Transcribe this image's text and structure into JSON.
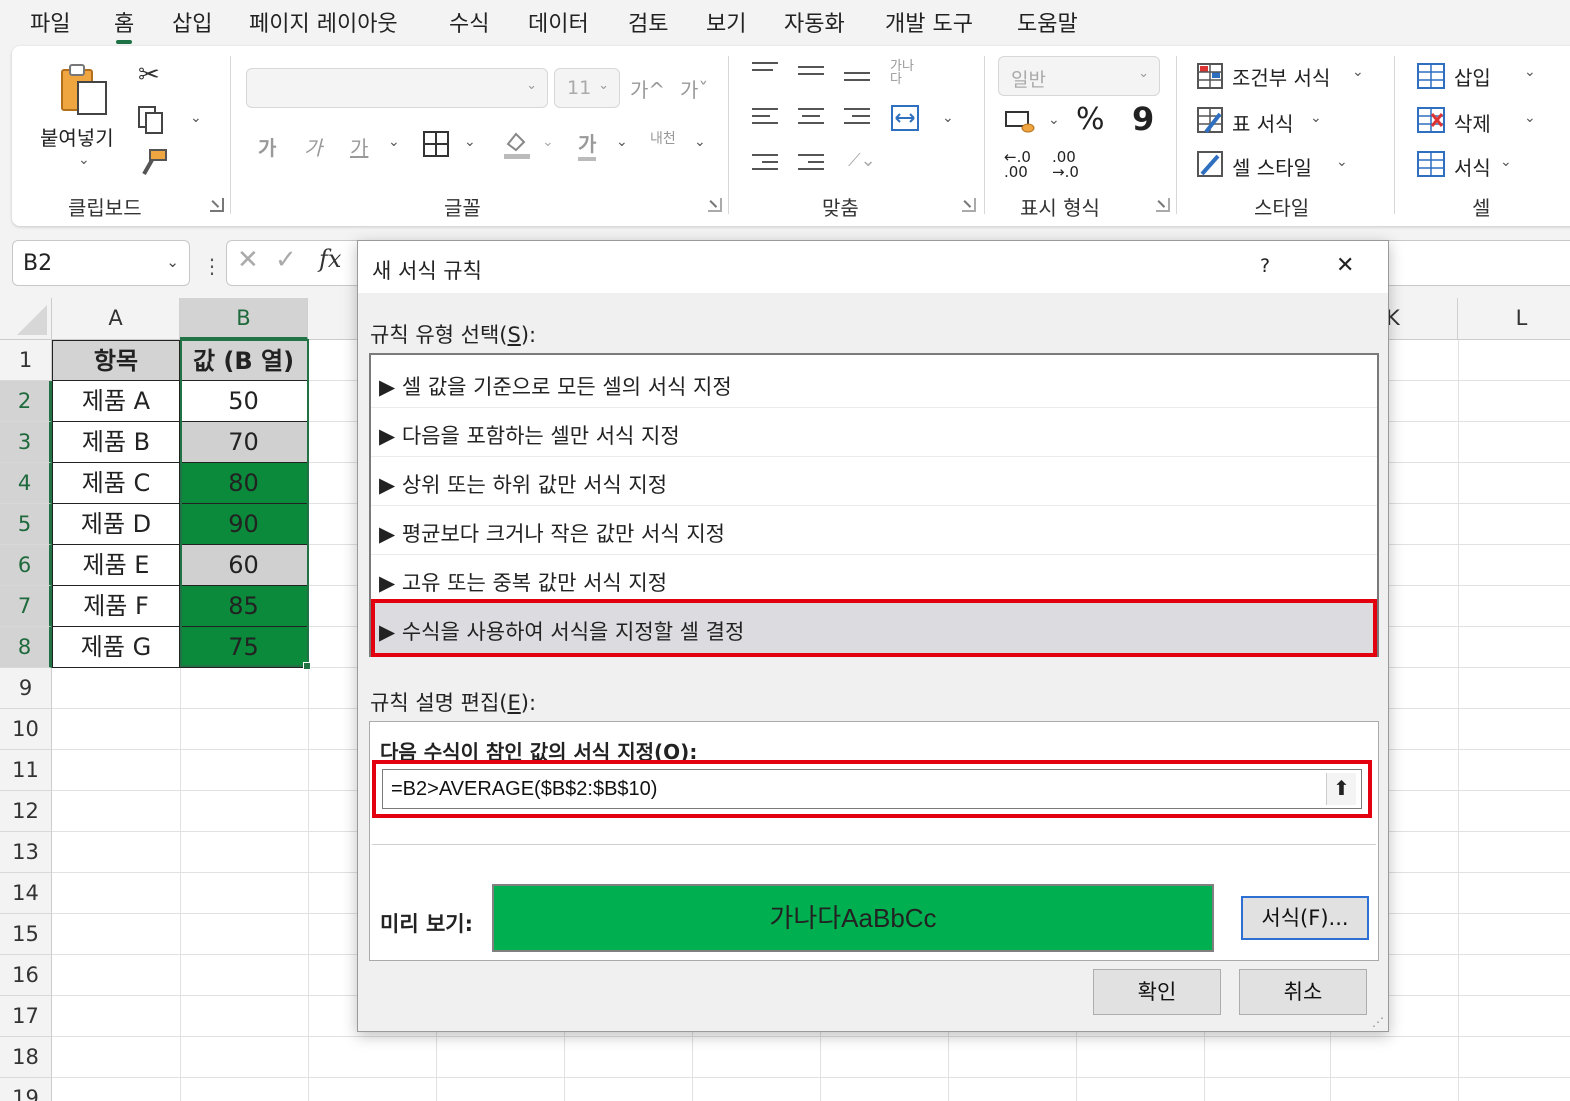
{
  "menu": {
    "tabs": [
      "파일",
      "홈",
      "삽입",
      "페이지 레이아웃",
      "수식",
      "데이터",
      "검토",
      "보기",
      "자동화",
      "개발 도구",
      "도움말"
    ],
    "active": "홈"
  },
  "ribbon": {
    "clipboard": {
      "label": "클립보드",
      "paste": "붙여넣기"
    },
    "font": {
      "label": "글꼴",
      "size": "11",
      "increase": "가^",
      "decrease": "가ˇ",
      "bold": "가",
      "italic": "가",
      "underline": "가",
      "font_color": "가",
      "wrap_label": "내천"
    },
    "align": {
      "label": "맞춤",
      "orient": "가나다"
    },
    "number": {
      "label": "표시 형식",
      "format": "일반",
      "percent": "%",
      "comma": "9",
      "inc_dec": "←.0 .00",
      "dec_dec": ".00 →.0"
    },
    "styles": {
      "label": "스타일",
      "cond_format": "조건부 서식",
      "table_format": "표 서식",
      "cell_style": "셀 스타일"
    },
    "cells": {
      "label": "셀",
      "insert": "삽입",
      "delete": "삭제",
      "format": "서식"
    }
  },
  "formula_bar": {
    "name_box": "B2",
    "fx": "fx"
  },
  "sheet": {
    "columns": [
      "A",
      "B",
      "K",
      "L"
    ],
    "rows": [
      "1",
      "2",
      "3",
      "4",
      "5",
      "6",
      "7",
      "8",
      "9",
      "10",
      "11",
      "12",
      "13",
      "14",
      "15",
      "16",
      "17",
      "18",
      "19"
    ],
    "header": {
      "a": "항목",
      "b": "값 (B 열)"
    },
    "items": [
      {
        "label": "제품 A",
        "value": "50",
        "fill": "white"
      },
      {
        "label": "제품 B",
        "value": "70",
        "fill": "grey"
      },
      {
        "label": "제품 C",
        "value": "80",
        "fill": "green"
      },
      {
        "label": "제품 D",
        "value": "90",
        "fill": "green"
      },
      {
        "label": "제품 E",
        "value": "60",
        "fill": "grey"
      },
      {
        "label": "제품 F",
        "value": "85",
        "fill": "green"
      },
      {
        "label": "제품 G",
        "value": "75",
        "fill": "green"
      }
    ],
    "colors": {
      "grey": "#d0d0d0",
      "green": "#0a8a3a",
      "selection": "#217346"
    }
  },
  "dialog": {
    "title": "새 서식 규칙",
    "help": "?",
    "close": "✕",
    "rule_type_label": "규칙 유형 선택(",
    "rule_type_key": "S",
    "rule_type_suffix": "):",
    "rules": [
      "▶ 셀 값을 기준으로 모든 셀의 서식 지정",
      "▶ 다음을 포함하는 셀만 서식 지정",
      "▶ 상위 또는 하위 값만 서식 지정",
      "▶ 평균보다 크거나 작은 값만 서식 지정",
      "▶ 고유 또는 중복 값만 서식 지정",
      "▶ 수식을 사용하여 서식을 지정할 셀 결정"
    ],
    "selected_rule": 5,
    "edit_label": "규칙 설명 편집(",
    "edit_key": "E",
    "edit_suffix": "):",
    "formula_label": "다음 수식이 참인 값의 서식 지정(",
    "formula_key": "O",
    "formula_suffix": "):",
    "formula": "=B2>AVERAGE($B$2:$B$10)",
    "preview_label": "미리 보기:",
    "preview_text": "가나다AaBbCc",
    "preview_color": "#00b050",
    "format_btn": "서식(F)...",
    "ok": "확인",
    "cancel": "취소",
    "highlight_color": "#e3000f"
  }
}
